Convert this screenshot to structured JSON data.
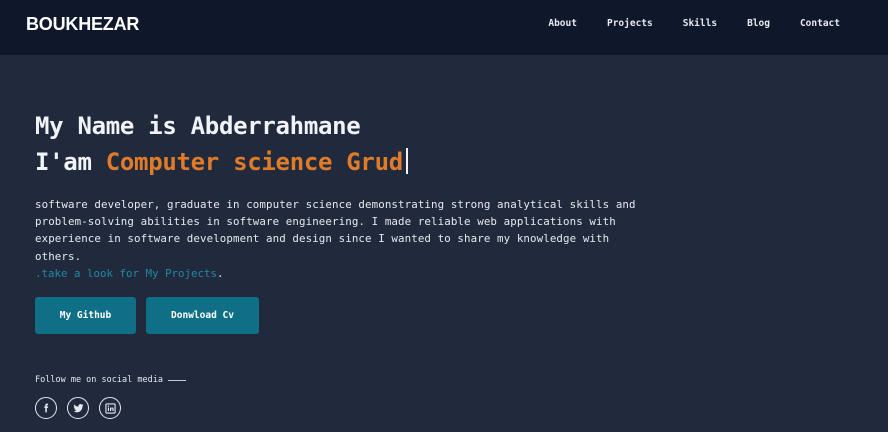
{
  "nav": {
    "brand": "BOUKHEZAR",
    "links": [
      "About",
      "Projects",
      "Skills",
      "Blog",
      "Contact"
    ]
  },
  "hero": {
    "line1": "My Name is Abderrahmane",
    "line2_prefix": "I'am ",
    "line2_role": "Computer science Grud",
    "intro": "software developer, graduate in computer science demonstrating strong analytical skills and problem-solving abilities in software engineering. I made reliable web applications with experience in software development and design since I wanted to share my knowledge with others.",
    "projects_link": ".take a look for My Projects",
    "projects_suffix": "."
  },
  "buttons": {
    "github": "My Github",
    "cv": "Donwload Cv"
  },
  "social": {
    "label": "Follow me on social media",
    "icons": [
      "facebook-icon",
      "twitter-icon",
      "linkedin-icon"
    ]
  },
  "colors": {
    "background": "#212a3d",
    "navbar": "#0f172b",
    "accent_orange": "#e07b2a",
    "accent_teal": "#0f6f86",
    "link_teal": "#1f8aa3"
  }
}
